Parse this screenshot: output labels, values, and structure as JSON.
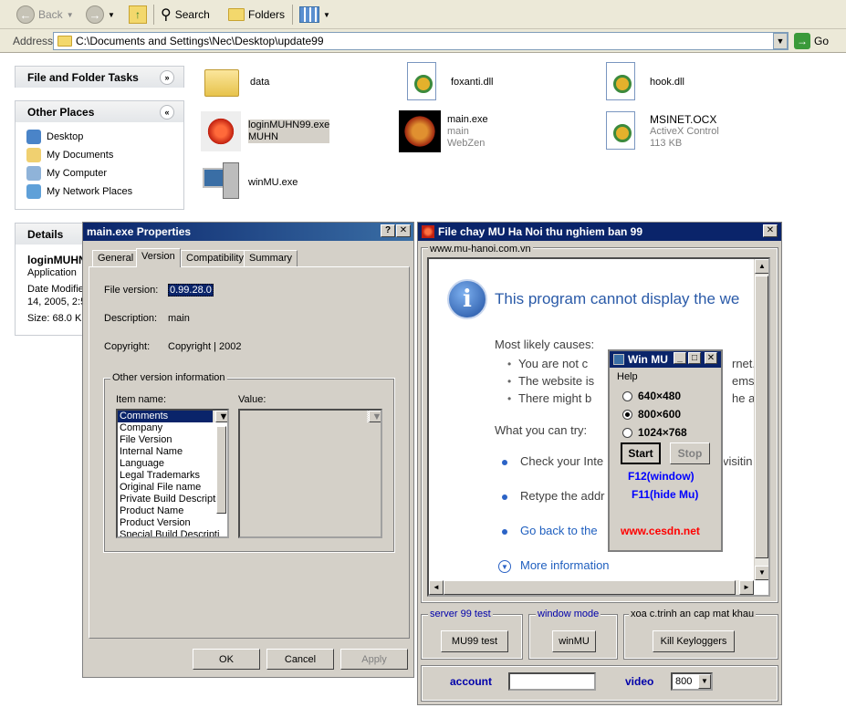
{
  "toolbar": {
    "back": "Back",
    "search": "Search",
    "folders": "Folders"
  },
  "address": {
    "label": "Address",
    "path": "C:\\Documents and Settings\\Nec\\Desktop\\update99",
    "go": "Go"
  },
  "sidebar": {
    "tasks_title": "File and Folder Tasks",
    "other_title": "Other Places",
    "places": [
      "Desktop",
      "My Documents",
      "My Computer",
      "My Network Places"
    ],
    "details_title": "Details",
    "details": {
      "name": "loginMUHN",
      "type": "Application",
      "date1": "Date Modifie",
      "date2": "14, 2005, 2:5",
      "size": "Size: 68.0 KI"
    }
  },
  "files": [
    {
      "name": "data",
      "line2": "",
      "line3": ""
    },
    {
      "name": "foxanti.dll",
      "line2": "",
      "line3": ""
    },
    {
      "name": "hook.dll",
      "line2": "",
      "line3": ""
    },
    {
      "name": "loginMUHN99.exe",
      "line2": "MUHN",
      "line3": ""
    },
    {
      "name": "main.exe",
      "line2": "main",
      "line3": "WebZen"
    },
    {
      "name": "MSINET.OCX",
      "line2": "ActiveX Control",
      "line3": "113 KB"
    },
    {
      "name": "winMU.exe",
      "line2": "",
      "line3": ""
    }
  ],
  "props": {
    "title": "main.exe Properties",
    "tabs": [
      "General",
      "Version",
      "Compatibility",
      "Summary"
    ],
    "file_version_label": "File version:",
    "file_version": "0.99.28.0",
    "description_label": "Description:",
    "description": "main",
    "copyright_label": "Copyright:",
    "copyright": "Copyright | 2002",
    "group_label": "Other version information",
    "item_name_label": "Item name:",
    "value_label": "Value:",
    "items": [
      "Comments",
      "Company",
      "File Version",
      "Internal Name",
      "Language",
      "Legal Trademarks",
      "Original File name",
      "Private Build Descripti",
      "Product Name",
      "Product Version",
      "Special Build Descripti"
    ],
    "ok": "OK",
    "cancel": "Cancel",
    "apply": "Apply"
  },
  "mu": {
    "title": "File chay MU Ha Noi thu nghiem ban 99",
    "site_legend": "www.mu-hanoi.com.vn",
    "web": {
      "headline": "This program cannot display the we",
      "causes": "Most likely causes:",
      "c1": "You are not c",
      "c1b": "rnet.",
      "c2": "The website is",
      "c2b": "ems.",
      "c3": "There might b",
      "c3b": "he add",
      "try": "What you can try:",
      "t1": "Check your Inte",
      "t1b": "visitin",
      "t2": "Retype the addr",
      "t3": "Go back to the",
      "more": "More information"
    },
    "g1_legend": "server 99 test",
    "g1_btn": "MU99 test",
    "g2_legend": "window mode",
    "g2_btn": "winMU",
    "g3_legend": "xoa c.trinh an cap mat khau",
    "g3_btn": "Kill Keyloggers",
    "account_label": "account",
    "video_label": "video",
    "video_value": "800"
  },
  "winmu": {
    "title": "Win MU",
    "help": "Help",
    "res": [
      "640×480",
      "800×600",
      "1024×768"
    ],
    "start": "Start",
    "stop": "Stop",
    "f12": "F12(window)",
    "f11": "F11(hide Mu)",
    "site": "www.cesdn.net"
  }
}
